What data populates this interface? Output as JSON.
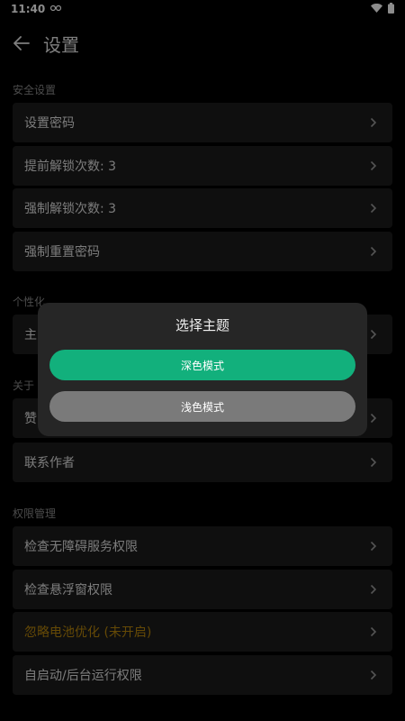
{
  "status_bar": {
    "time": "11:40"
  },
  "header": {
    "title": "设置"
  },
  "sections": [
    {
      "title": "安全设置",
      "items": [
        {
          "label": "设置密码"
        },
        {
          "label": "提前解锁次数: 3"
        },
        {
          "label": "强制解锁次数: 3"
        },
        {
          "label": "强制重置密码"
        }
      ]
    },
    {
      "title": "个性化",
      "items": [
        {
          "label": "主"
        }
      ]
    },
    {
      "title": "关于",
      "items": [
        {
          "label": "赞"
        },
        {
          "label": "联系作者"
        }
      ]
    },
    {
      "title": "权限管理",
      "items": [
        {
          "label": "检查无障碍服务权限"
        },
        {
          "label": "检查悬浮窗权限"
        },
        {
          "label": "忽略电池优化 (未开启)"
        },
        {
          "label": "自启动/后台运行权限"
        }
      ]
    }
  ],
  "dialog": {
    "title": "选择主题",
    "options": [
      {
        "label": "深色模式"
      },
      {
        "label": "浅色模式"
      }
    ]
  },
  "colors": {
    "accent": "#12b07c",
    "warning": "#b8860b",
    "card": "#1c1c1c",
    "background": "#000000"
  }
}
